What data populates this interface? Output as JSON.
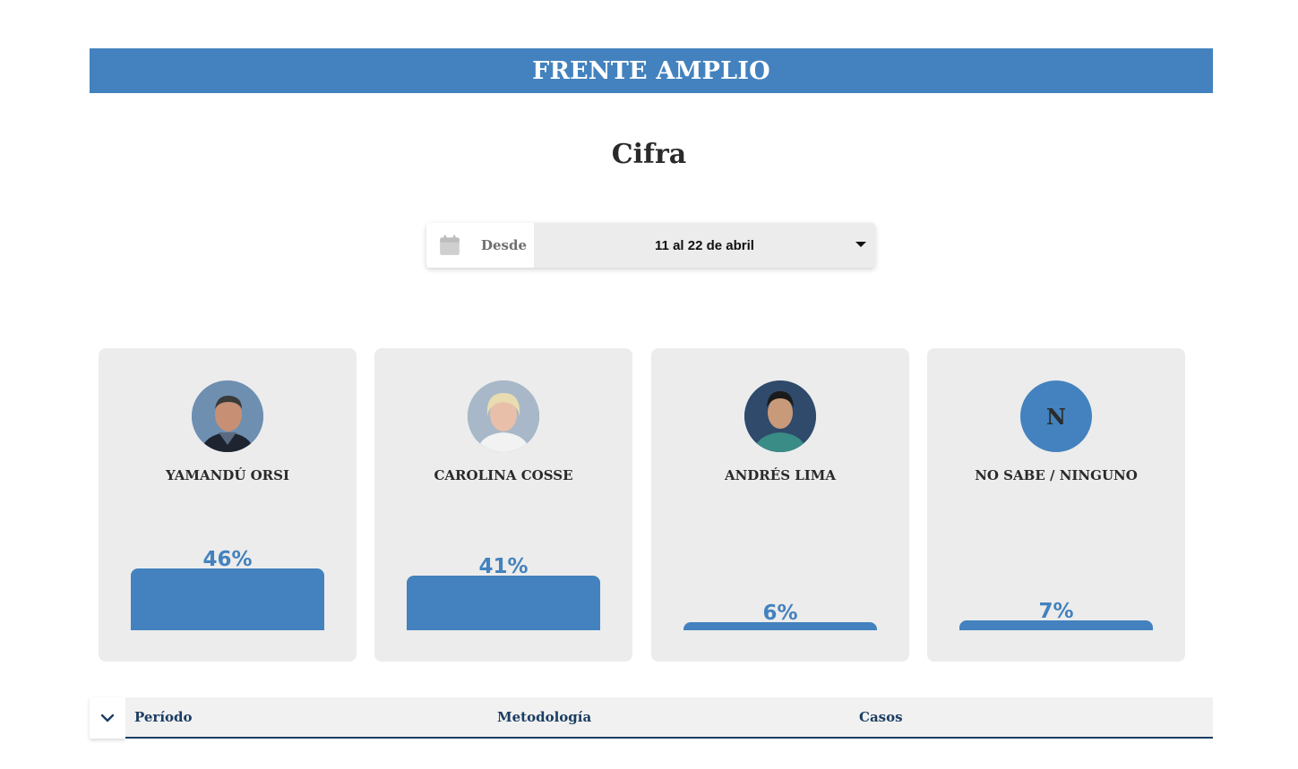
{
  "banner": {
    "title": "FRENTE AMPLIO"
  },
  "page": {
    "title": "Cifra"
  },
  "date_filter": {
    "icon": "calendar-icon",
    "label": "Desde",
    "selected": "11 al 22 de abril",
    "caret_icon": "caret-down-icon"
  },
  "colors": {
    "accent": "#4382be",
    "card_bg": "#ececec",
    "header_text": "#1b3d63"
  },
  "candidates": [
    {
      "name": "YAMANDÚ ORSI",
      "percent": 46,
      "percent_label": "46%",
      "avatar": "photo"
    },
    {
      "name": "CAROLINA COSSE",
      "percent": 41,
      "percent_label": "41%",
      "avatar": "photo"
    },
    {
      "name": "ANDRÉS LIMA",
      "percent": 6,
      "percent_label": "6%",
      "avatar": "photo"
    },
    {
      "name": "NO SABE / NINGUNO",
      "percent": 7,
      "percent_label": "7%",
      "avatar": "letter",
      "letter": "N"
    }
  ],
  "details_table": {
    "toggle_icon": "chevron-down-icon",
    "columns": [
      "Período",
      "Metodología",
      "Casos"
    ]
  }
}
